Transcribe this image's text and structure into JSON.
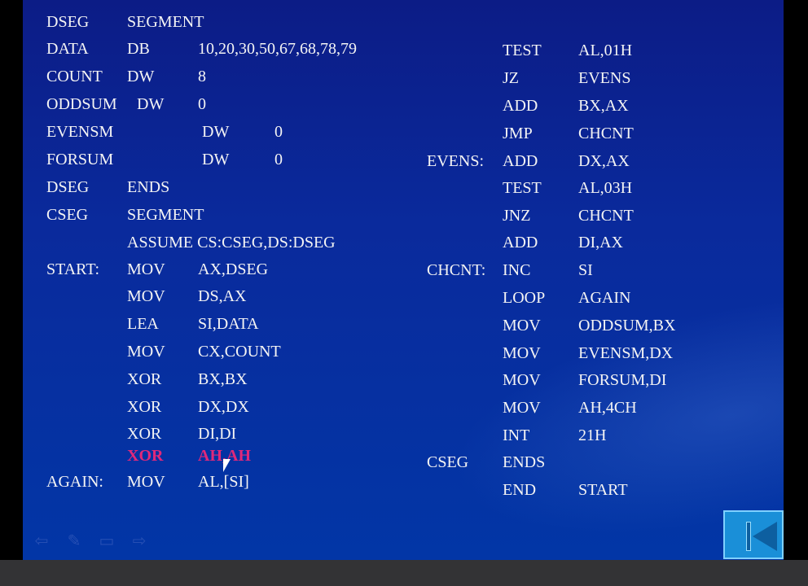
{
  "slide": {
    "left_code": [
      [
        "DSEG",
        "SEGMENT",
        ""
      ],
      [
        "DATA",
        "DB",
        "10,20,30,50,67,68,78,79"
      ],
      [
        "COUNT",
        "DW",
        "8"
      ],
      [
        "ODDSUM",
        "DW",
        "0"
      ],
      [
        "EVENSM",
        "DW",
        "0"
      ],
      [
        "FORSUM",
        "DW",
        "0"
      ],
      [
        "DSEG",
        "ENDS",
        ""
      ],
      [
        "CSEG",
        "SEGMENT",
        ""
      ],
      [
        "",
        "ASSUME  CS:CSEG,DS:DSEG",
        ""
      ],
      [
        "START:",
        "MOV",
        "AX,DSEG"
      ],
      [
        "",
        "MOV",
        "DS,AX"
      ],
      [
        "",
        "LEA",
        "SI,DATA"
      ],
      [
        "",
        "MOV",
        "CX,COUNT"
      ],
      [
        "",
        "XOR",
        "BX,BX"
      ],
      [
        "",
        "XOR",
        "DX,DX"
      ],
      [
        "",
        "XOR",
        "DI,DI"
      ],
      [
        "",
        "XOR",
        "AH,AH"
      ],
      [
        "AGAIN:",
        "MOV",
        "AL,[SI]"
      ]
    ],
    "right_code": [
      [
        "",
        "TEST",
        "AL,01H"
      ],
      [
        "",
        "JZ",
        "EVENS"
      ],
      [
        "",
        "ADD",
        "BX,AX"
      ],
      [
        "",
        "JMP",
        "CHCNT"
      ],
      [
        "EVENS:",
        "ADD",
        "DX,AX"
      ],
      [
        "",
        "TEST",
        "AL,03H"
      ],
      [
        "",
        "JNZ",
        "CHCNT"
      ],
      [
        "",
        "ADD",
        "DI,AX"
      ],
      [
        "CHCNT:",
        "INC",
        "SI"
      ],
      [
        "",
        "LOOP",
        "AGAIN"
      ],
      [
        "",
        "MOV",
        "ODDSUM,BX"
      ],
      [
        "",
        "MOV",
        "EVENSM,DX"
      ],
      [
        "",
        "MOV",
        "FORSUM,DI"
      ],
      [
        "",
        "MOV",
        "AH,4CH"
      ],
      [
        "",
        "INT",
        "21H"
      ],
      [
        "CSEG",
        "ENDS",
        ""
      ],
      [
        "",
        "END",
        "START"
      ]
    ],
    "highlight_color": "#e0287a",
    "nav_icons": [
      "arrow-left-icon",
      "pen-icon",
      "screen-icon",
      "arrow-right-icon"
    ],
    "back_button_icon": "first-slide-icon"
  }
}
